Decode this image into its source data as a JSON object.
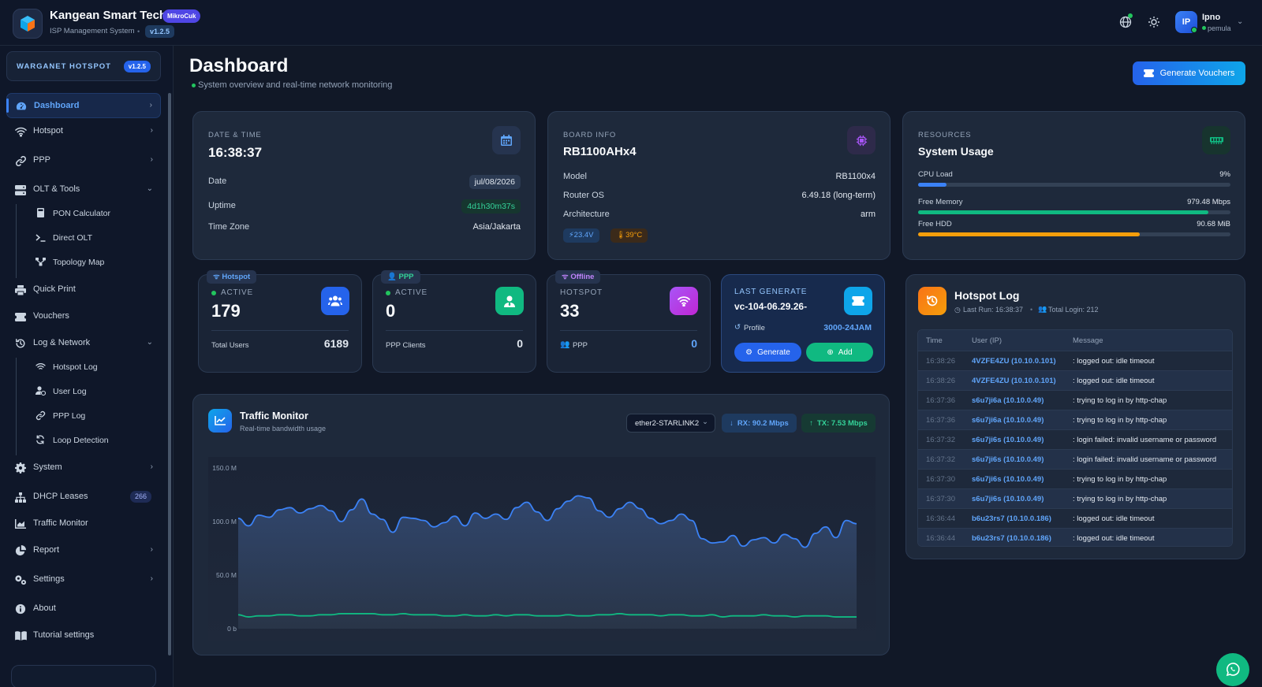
{
  "header": {
    "brand_title": "Kangean Smart Tech",
    "brand_badge": "MikroCuk",
    "brand_sub": "ISP Management System",
    "version": "v1.2.5",
    "user_initials": "IP",
    "user_name": "Ipno",
    "user_role": "pemula"
  },
  "sidebar": {
    "hotspot_card_title": "WARGANET HOTSPOT",
    "hotspot_card_version": "v1.2.5",
    "items": {
      "dashboard": "Dashboard",
      "hotspot": "Hotspot",
      "ppp": "PPP",
      "olt_tools": "OLT & Tools",
      "pon_calculator": "PON Calculator",
      "direct_olt": "Direct OLT",
      "topology_map": "Topology Map",
      "quick_print": "Quick Print",
      "vouchers": "Vouchers",
      "log_network": "Log & Network",
      "hotspot_log": "Hotspot Log",
      "user_log": "User Log",
      "ppp_log": "PPP Log",
      "loop_detection": "Loop Detection",
      "system": "System",
      "dhcp_leases": "DHCP Leases",
      "dhcp_count": "266",
      "traffic_monitor": "Traffic Monitor",
      "report": "Report",
      "settings": "Settings",
      "about": "About",
      "tutorial_settings": "Tutorial settings"
    }
  },
  "page": {
    "title": "Dashboard",
    "subtitle": "System overview and real-time network monitoring",
    "generate_button": "Generate Vouchers"
  },
  "datetime": {
    "label": "DATE & TIME",
    "time": "16:38:37",
    "date_label": "Date",
    "date_value": "jul/08/2026",
    "uptime_label": "Uptime",
    "uptime_value": "4d1h30m37s",
    "tz_label": "Time Zone",
    "tz_value": "Asia/Jakarta"
  },
  "board": {
    "label": "BOARD INFO",
    "name": "RB1100AHx4",
    "model_label": "Model",
    "model_value": "RB1100x4",
    "os_label": "Router OS",
    "os_value": "6.49.18 (long-term)",
    "arch_label": "Architecture",
    "arch_value": "arm",
    "voltage": "23.4V",
    "temperature": "39°C"
  },
  "resources": {
    "label": "RESOURCES",
    "title": "System Usage",
    "cpu_label": "CPU Load",
    "cpu_value": "9%",
    "cpu_fraction": 0.09,
    "mem_label": "Free Memory",
    "mem_value": "979.48 Mbps",
    "mem_fraction": 0.93,
    "hdd_label": "Free HDD",
    "hdd_value": "90.68 MiB",
    "hdd_fraction": 0.71
  },
  "stats": {
    "hotspot": {
      "tag": "Hotspot",
      "status": "ACTIVE",
      "value": "179",
      "foot_label": "Total Users",
      "foot_value": "6189"
    },
    "ppp": {
      "tag": "PPP",
      "status": "ACTIVE",
      "value": "0",
      "foot_label": "PPP Clients",
      "foot_value": "0"
    },
    "offline": {
      "tag": "Offline",
      "status": "HOTSPOT",
      "value": "33",
      "foot_label": "PPP",
      "foot_value": "0"
    },
    "last_generate": {
      "label": "LAST GENERATE",
      "value": "vc-104-06.29.26-",
      "profile_label": "Profile",
      "profile_value": "3000-24JAM",
      "generate_btn": "Generate",
      "add_btn": "Add"
    }
  },
  "traffic": {
    "title": "Traffic Monitor",
    "subtitle": "Real-time bandwidth usage",
    "interface": "ether2-STARLINK2",
    "rx": "RX: 90.2 Mbps",
    "tx": "TX: 7.53 Mbps",
    "colors": {
      "rx": "#3b82f6",
      "tx": "#10b981"
    }
  },
  "chart_data": {
    "type": "area",
    "title": "",
    "xlabel": "",
    "ylabel": "",
    "ylim": [
      0,
      150
    ],
    "yticks": [
      "0 b",
      "50.0 M",
      "100.0 M",
      "150.0 M"
    ],
    "grid": false,
    "series": [
      {
        "values": [
          103,
          96,
          106,
          104,
          111,
          113,
          108,
          112,
          115,
          110,
          100,
          111,
          121,
          107,
          102,
          90,
          104,
          103,
          101,
          95,
          99,
          105,
          96,
          108,
          103,
          107,
          102,
          113,
          118,
          109,
          101,
          112,
          119,
          124,
          122,
          110,
          104,
          112,
          118,
          112,
          103,
          98,
          101,
          107,
          101,
          84,
          80,
          81,
          87,
          77,
          83,
          85,
          80,
          88,
          84,
          76,
          89,
          95,
          85,
          101,
          98
        ]
      },
      {
        "values": [
          13,
          11,
          12,
          12,
          13,
          13,
          12,
          12,
          13,
          13,
          14,
          14,
          14,
          14,
          13,
          13,
          14,
          13,
          13,
          13,
          12,
          12,
          13,
          12,
          12,
          13,
          12,
          13,
          13,
          12,
          12,
          12,
          13,
          12,
          12,
          13,
          13,
          14,
          13,
          13,
          13,
          12,
          13,
          13,
          12,
          12,
          13,
          11,
          12,
          12,
          12,
          13,
          12,
          12,
          11,
          12,
          12,
          12,
          11,
          11,
          11
        ]
      }
    ]
  },
  "hotspot_log": {
    "title": "Hotspot Log",
    "last_run": "Last Run: 16:38:37",
    "total_login": "Total Login: 212",
    "columns": [
      "Time",
      "User (IP)",
      "Message"
    ],
    "rows": [
      [
        "16:38:26",
        "4VZFE4ZU (10.10.0.101)",
        ": logged out: idle timeout"
      ],
      [
        "16:38:26",
        "4VZFE4ZU (10.10.0.101)",
        ": logged out: idle timeout"
      ],
      [
        "16:37:36",
        "s6u7ji6a (10.10.0.49)",
        ": trying to log in by http-chap"
      ],
      [
        "16:37:36",
        "s6u7ji6a (10.10.0.49)",
        ": trying to log in by http-chap"
      ],
      [
        "16:37:32",
        "s6u7ji6s (10.10.0.49)",
        ": login failed: invalid username or password"
      ],
      [
        "16:37:32",
        "s6u7ji6s (10.10.0.49)",
        ": login failed: invalid username or password"
      ],
      [
        "16:37:30",
        "s6u7ji6s (10.10.0.49)",
        ": trying to log in by http-chap"
      ],
      [
        "16:37:30",
        "s6u7ji6s (10.10.0.49)",
        ": trying to log in by http-chap"
      ],
      [
        "16:36:44",
        "b6u23rs7 (10.10.0.186)",
        ": logged out: idle timeout"
      ],
      [
        "16:36:44",
        "b6u23rs7 (10.10.0.186)",
        ": logged out: idle timeout"
      ]
    ]
  }
}
